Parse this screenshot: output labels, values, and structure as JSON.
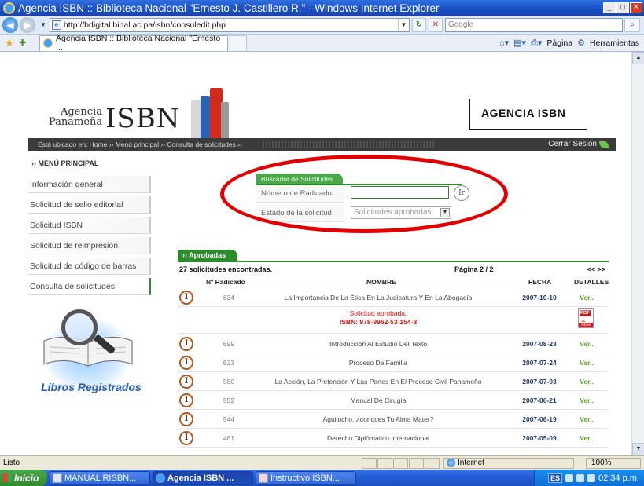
{
  "window": {
    "title": "Agencia ISBN :: Biblioteca Nacional \"Ernesto J. Castillero R.\" - Windows Internet Explorer",
    "url": "http://bdigital.binal.ac.pa/isbn/consuledit.php",
    "search_placeholder": "Google",
    "tab_label": "Agencia ISBN :: Biblioteca Nacional \"Ernesto ...",
    "tools": {
      "page": "Página",
      "tools": "Herramientas"
    }
  },
  "header": {
    "logo_agencia": "Agencia",
    "logo_panamena": "Panameña",
    "logo_isbn": "ISBN",
    "right_title": "AGENCIA ISBN"
  },
  "breadcrumb": {
    "text": "Está ubicado en: Home ›› Menú principal ›› Consulta de solicitudes ››",
    "logout": "Cerrar Sesión"
  },
  "sidebar": {
    "heading": "›› MENÚ PRINCIPAL",
    "items": [
      "Información general",
      "Solicitud de sello editorial",
      "Solicitud ISBN",
      "Solicitud de reimpresión",
      "Solicitud de código de barras",
      "Consulta de solicitudes"
    ],
    "image_caption": "Libros Registrados"
  },
  "search": {
    "tab": "Buscador de Solicitudes",
    "radicado_label": "Número de Radicado.",
    "radicado_value": "",
    "go_label": "Ir",
    "estado_label": "Estado de la solicitud",
    "estado_value": "Solicitudes aprobadas"
  },
  "results": {
    "tab": "›› Aprobadas",
    "count_text": "27 solicitudes encontradas.",
    "page_text": "Página 2 / 2",
    "pager": "<< >>",
    "headers": {
      "radicado": "Nº Radicado",
      "nombre": "NOMBRE",
      "fecha": "FECHA",
      "detalles": "DETALLES"
    },
    "approved_msg_line1": "Solicitud aprobada.",
    "approved_msg_line2": "ISBN: 978-9962-53-154-8",
    "pdf_label": "PDF",
    "pdf_vendor": "Adobe",
    "rows": [
      {
        "radicado": "834",
        "nombre": "La Importancia De La Ética En La Judicatura Y En La Abogacía",
        "fecha": "2007-10-10",
        "detalles": "Ver.."
      },
      {
        "radicado": "699",
        "nombre": "Introducción Al Estudio Del Texto",
        "fecha": "2007-08-23",
        "detalles": "Ver.."
      },
      {
        "radicado": "623",
        "nombre": "Proceso De Familia",
        "fecha": "2007-07-24",
        "detalles": "Ver.."
      },
      {
        "radicado": "580",
        "nombre": "La Acción, La Pretención Y Las Partes En El Proceso Civil Panameño",
        "fecha": "2007-07-03",
        "detalles": "Ver.."
      },
      {
        "radicado": "552",
        "nombre": "Manual De Cirugía",
        "fecha": "2007-06-21",
        "detalles": "Ver.."
      },
      {
        "radicado": "544",
        "nombre": "Aguilucho, ¿conoces Tu Alma Mater?",
        "fecha": "2007-06-19",
        "detalles": "Ver.."
      },
      {
        "radicado": "461",
        "nombre": "Derecho Diplómatico Internacional",
        "fecha": "2007-05-09",
        "detalles": "Ver.."
      }
    ]
  },
  "statusbar": {
    "text": "Listo",
    "zone": "Internet",
    "zoom": "100%"
  },
  "taskbar": {
    "start": "Inicio",
    "tasks": [
      "MANUAL RISBN...",
      "Agencia ISBN ...",
      "Instructivo ISBN..."
    ],
    "lang": "ES",
    "clock": "02:34 p.m."
  },
  "colors": {
    "accent_green": "#2d8a2d",
    "highlight_red": "#e00000",
    "date_blue": "#1f3a6e",
    "link_green": "#5aa520"
  }
}
